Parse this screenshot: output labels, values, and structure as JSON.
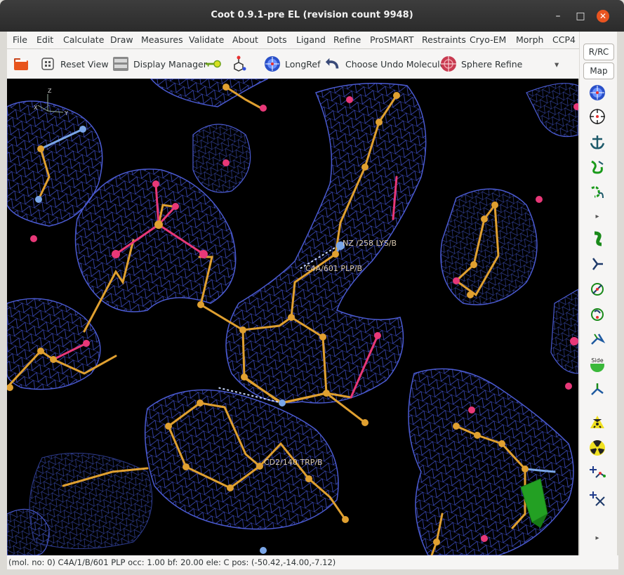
{
  "window": {
    "title": "Coot 0.9.1-pre EL (revision count 9948)",
    "minimize": "–",
    "maximize": "□",
    "close": "✕"
  },
  "menu": [
    "File",
    "Edit",
    "Calculate",
    "Draw",
    "Measures",
    "Validate",
    "About",
    "Dots",
    "Ligand",
    "Refine",
    "ProSMART",
    "Restraints",
    "Cryo-EM",
    "Morph",
    "CCP4"
  ],
  "toolbar": {
    "reset_view": "Reset View",
    "display_manager": "Display Manager",
    "longref": "LongRef",
    "choose_undo": "Choose Undo Molecule",
    "sphere_refine": "Sphere Refine",
    "overflow": "▾"
  },
  "rightbar": {
    "rrc": "R/RC",
    "map": "Map",
    "side_label": "Side",
    "more_top": "▸",
    "more_bottom": "▸"
  },
  "labels": {
    "nz": "NZ /258 LYS/B",
    "c4a": "C4A/601 PLP/B",
    "cd2": "CD2/140 TRP/B"
  },
  "axes": {
    "x": "X",
    "y": "Y",
    "z": "Z"
  },
  "status": "(mol. no: 0)  C4A/1/B/601 PLP occ:  1.00 bf: 20.00 ele:  C pos: (-50.42,-14.00,-7.12)",
  "colors": {
    "mesh": "#3a4ab8",
    "carbon": "#e0a030",
    "oxygen": "#e83878",
    "nitrogen": "#7aa6e8"
  }
}
